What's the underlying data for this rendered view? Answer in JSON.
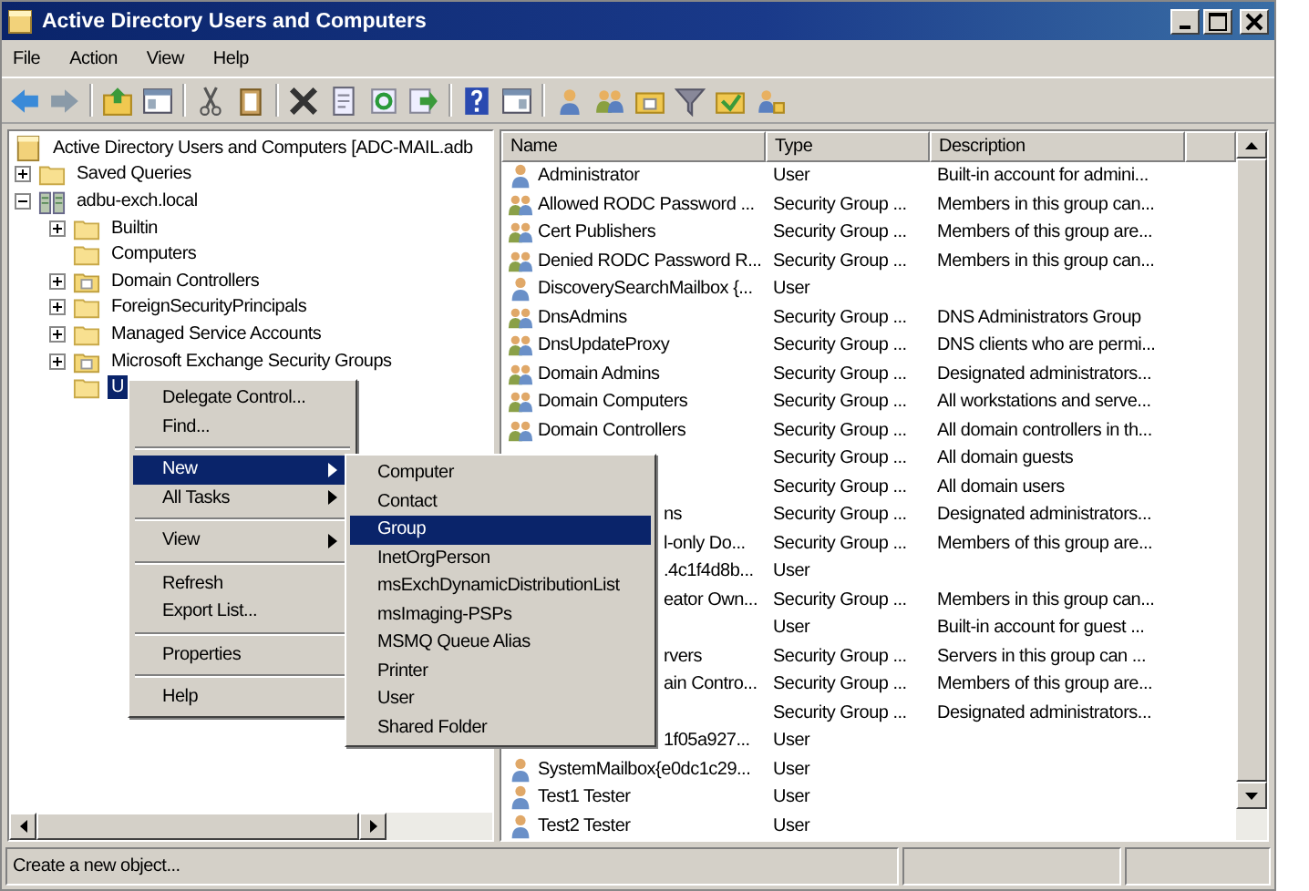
{
  "window": {
    "title": "Active Directory Users and Computers"
  },
  "menu": [
    "File",
    "Action",
    "View",
    "Help"
  ],
  "tree": [
    {
      "label": "Active Directory Users and Computers [ADC-MAIL.adb",
      "kind": "console",
      "selected": false,
      "children": [
        {
          "label": "Saved Queries",
          "kind": "folder",
          "expanded": false,
          "selected": false
        },
        {
          "label": "adbu-exch.local",
          "kind": "domain",
          "expanded": true,
          "selected": false,
          "children": [
            {
              "label": "Builtin",
              "kind": "folder",
              "expanded": false,
              "selected": false
            },
            {
              "label": "Computers",
              "kind": "folder",
              "selected": false
            },
            {
              "label": "Domain Controllers",
              "kind": "ou",
              "expanded": false,
              "selected": false
            },
            {
              "label": "ForeignSecurityPrincipals",
              "kind": "folder",
              "expanded": false,
              "selected": false
            },
            {
              "label": "Managed Service Accounts",
              "kind": "folder",
              "expanded": false,
              "selected": false
            },
            {
              "label": "Microsoft Exchange Security Groups",
              "kind": "ou",
              "expanded": false,
              "selected": false
            },
            {
              "label": "U",
              "kind": "folder",
              "selected": true
            }
          ]
        }
      ]
    }
  ],
  "columns": [
    "Name",
    "Type",
    "Description"
  ],
  "rows": [
    {
      "kind": "user",
      "name": "Administrator",
      "type": "User",
      "description": "Built-in account for admini..."
    },
    {
      "kind": "group",
      "name": "Allowed RODC Password ...",
      "type": "Security Group ...",
      "description": "Members in this group can..."
    },
    {
      "kind": "group",
      "name": "Cert Publishers",
      "type": "Security Group ...",
      "description": "Members of this group are..."
    },
    {
      "kind": "group",
      "name": "Denied RODC Password R...",
      "type": "Security Group ...",
      "description": "Members in this group can..."
    },
    {
      "kind": "user",
      "name": "DiscoverySearchMailbox {...",
      "type": "User"
    },
    {
      "kind": "group",
      "name": "DnsAdmins",
      "type": "Security Group ...",
      "description": "DNS Administrators Group"
    },
    {
      "kind": "group",
      "name": "DnsUpdateProxy",
      "type": "Security Group ...",
      "description": "DNS clients who are permi..."
    },
    {
      "kind": "group",
      "name": "Domain Admins",
      "type": "Security Group ...",
      "description": "Designated administrators..."
    },
    {
      "kind": "group",
      "name": "Domain Computers",
      "type": "Security Group ...",
      "description": "All workstations and serve..."
    },
    {
      "kind": "group",
      "name": "Domain Controllers",
      "type": "Security Group ...",
      "description": "All domain controllers in th..."
    },
    {
      "type": "Security Group ...",
      "description": "All domain guests"
    },
    {
      "type": "Security Group ...",
      "description": "All domain users"
    },
    {
      "name": "ns",
      "partial": true,
      "type": "Security Group ...",
      "description": "Designated administrators..."
    },
    {
      "name": "l-only Do...",
      "partial": true,
      "type": "Security Group ...",
      "description": "Members of this group are..."
    },
    {
      "name": ".4c1f4d8b...",
      "partial": true,
      "type": "User"
    },
    {
      "name": "eator Own...",
      "partial": true,
      "type": "Security Group ...",
      "description": "Members in this group can..."
    },
    {
      "type": "User",
      "description": "Built-in account for guest ..."
    },
    {
      "name": "rvers",
      "partial": true,
      "type": "Security Group ...",
      "description": "Servers in this group can ..."
    },
    {
      "name": "ain Contro...",
      "partial": true,
      "type": "Security Group ...",
      "description": "Members of this group are..."
    },
    {
      "type": "Security Group ...",
      "description": "Designated administrators..."
    },
    {
      "name": "1f05a927...",
      "partial": true,
      "type": "User"
    },
    {
      "kind": "user",
      "name": "SystemMailbox{e0dc1c29...",
      "type": "User"
    },
    {
      "kind": "user",
      "name": "Test1 Tester",
      "type": "User"
    },
    {
      "kind": "user",
      "name": "Test2 Tester",
      "type": "User"
    }
  ],
  "context_menu": [
    {
      "kind": "item",
      "label": "Delegate Control...",
      "selected": false
    },
    {
      "kind": "item",
      "label": "Find...",
      "selected": false
    },
    {
      "kind": "sep"
    },
    {
      "kind": "submenu",
      "label": "New",
      "selected": true
    },
    {
      "kind": "submenu",
      "label": "All Tasks",
      "selected": false
    },
    {
      "kind": "sep"
    },
    {
      "kind": "submenu",
      "label": "View",
      "selected": false
    },
    {
      "kind": "sep"
    },
    {
      "kind": "item",
      "label": "Refresh",
      "selected": false
    },
    {
      "kind": "item",
      "label": "Export List...",
      "selected": false
    },
    {
      "kind": "sep"
    },
    {
      "kind": "item",
      "label": "Properties",
      "selected": false
    },
    {
      "kind": "sep"
    },
    {
      "kind": "item",
      "label": "Help",
      "selected": false
    }
  ],
  "submenu": [
    {
      "label": "Computer",
      "selected": false
    },
    {
      "label": "Contact",
      "selected": false
    },
    {
      "label": "Group",
      "selected": true
    },
    {
      "label": "InetOrgPerson",
      "selected": false
    },
    {
      "label": "msExchDynamicDistributionList",
      "selected": false
    },
    {
      "label": "msImaging-PSPs",
      "selected": false
    },
    {
      "label": "MSMQ Queue Alias",
      "selected": false
    },
    {
      "label": "Printer",
      "selected": false
    },
    {
      "label": "User",
      "selected": false
    },
    {
      "label": "Shared Folder",
      "selected": false
    }
  ],
  "status_bar": "Create a new object..."
}
